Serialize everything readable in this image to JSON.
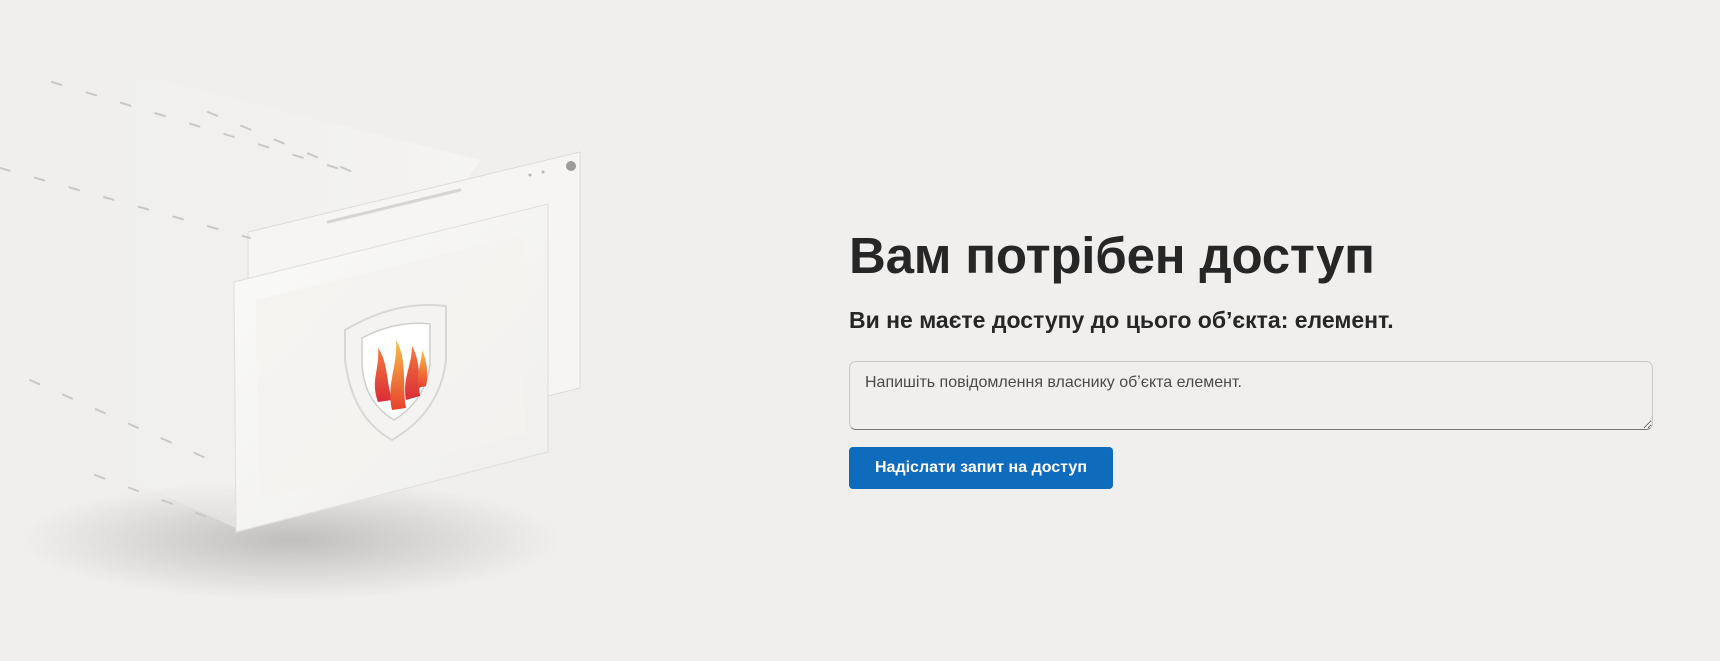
{
  "page": {
    "heading": "Вам потрібен доступ",
    "subheading": "Ви не маєте доступу до цього обʼєкта: елемент."
  },
  "request_form": {
    "message_placeholder": "Напишіть повідомлення власнику обʼєкта елемент.",
    "message_value": "",
    "submit_label": "Надіслати запит на доступ"
  },
  "illustration": {
    "icon": "shield-lock-icon"
  },
  "colors": {
    "background": "#f0efed",
    "accent": "#0f6cbd",
    "text": "#262626"
  }
}
